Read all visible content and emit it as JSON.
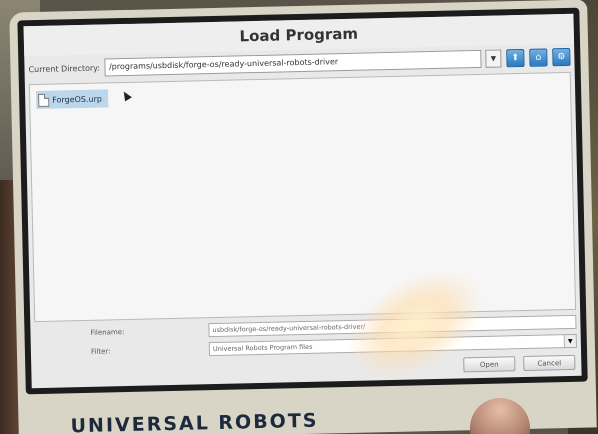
{
  "dialog": {
    "title": "Load Program"
  },
  "directory": {
    "label": "Current Directory:",
    "value": "/programs/usbdisk/forge-os/ready-universal-robots-driver",
    "dropdown_icon": "triangle-down-icon"
  },
  "nav_buttons": [
    {
      "icon": "up-arrow-icon",
      "glyph": "⬆"
    },
    {
      "icon": "home-icon",
      "glyph": "⌂"
    },
    {
      "icon": "gear-icon",
      "glyph": "⚙"
    }
  ],
  "files": [
    {
      "name": "ForgeOS.urp",
      "selected": true
    }
  ],
  "filename": {
    "label": "Filename:",
    "value": "usbdisk/forge-os/ready-universal-robots-driver/"
  },
  "filter": {
    "label": "Filter:",
    "value": "Universal Robots Program files"
  },
  "buttons": {
    "open": "Open",
    "cancel": "Cancel"
  },
  "device": {
    "brand": "UNIVERSAL ROBOTS"
  },
  "colors": {
    "nav_button": "#2a79c3",
    "selection": "#bcd6ec"
  }
}
